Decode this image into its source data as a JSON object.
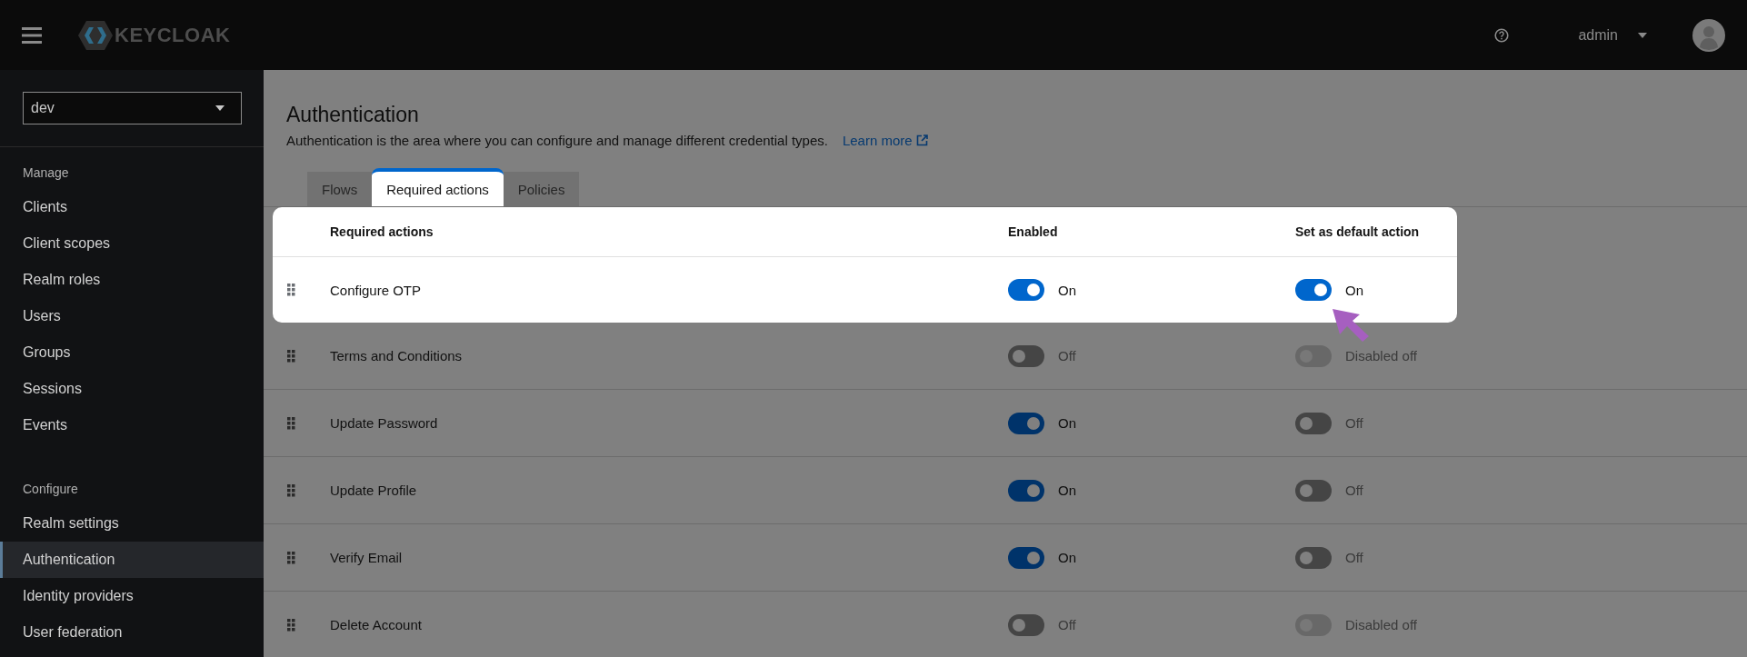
{
  "header": {
    "logo": "KEYCLOAK",
    "user": "admin"
  },
  "sidebar": {
    "realm": "dev",
    "sections": [
      {
        "title": "Manage",
        "items": [
          {
            "label": "Clients",
            "selected": false
          },
          {
            "label": "Client scopes",
            "selected": false
          },
          {
            "label": "Realm roles",
            "selected": false
          },
          {
            "label": "Users",
            "selected": false
          },
          {
            "label": "Groups",
            "selected": false
          },
          {
            "label": "Sessions",
            "selected": false
          },
          {
            "label": "Events",
            "selected": false
          }
        ]
      },
      {
        "title": "Configure",
        "items": [
          {
            "label": "Realm settings",
            "selected": false
          },
          {
            "label": "Authentication",
            "selected": true
          },
          {
            "label": "Identity providers",
            "selected": false
          },
          {
            "label": "User federation",
            "selected": false
          }
        ]
      }
    ]
  },
  "page": {
    "title": "Authentication",
    "description": "Authentication is the area where you can configure and manage different credential types.",
    "learn_more": "Learn more"
  },
  "tabs": [
    {
      "label": "Flows",
      "selected": false
    },
    {
      "label": "Required actions",
      "selected": true
    },
    {
      "label": "Policies",
      "selected": false
    }
  ],
  "table": {
    "columns": [
      "Required actions",
      "Enabled",
      "Set as default action"
    ],
    "rows": [
      {
        "name": "Configure OTP",
        "highlighted": true,
        "enabled": {
          "on": true,
          "disabled": false,
          "label": "On"
        },
        "default": {
          "on": true,
          "disabled": false,
          "label": "On"
        }
      },
      {
        "name": "Terms and Conditions",
        "highlighted": false,
        "enabled": {
          "on": false,
          "disabled": false,
          "label": "Off"
        },
        "default": {
          "on": false,
          "disabled": true,
          "label": "Disabled off"
        }
      },
      {
        "name": "Update Password",
        "highlighted": false,
        "enabled": {
          "on": true,
          "disabled": false,
          "label": "On"
        },
        "default": {
          "on": false,
          "disabled": false,
          "label": "Off"
        }
      },
      {
        "name": "Update Profile",
        "highlighted": false,
        "enabled": {
          "on": true,
          "disabled": false,
          "label": "On"
        },
        "default": {
          "on": false,
          "disabled": false,
          "label": "Off"
        }
      },
      {
        "name": "Verify Email",
        "highlighted": false,
        "enabled": {
          "on": true,
          "disabled": false,
          "label": "On"
        },
        "default": {
          "on": false,
          "disabled": false,
          "label": "Off"
        }
      },
      {
        "name": "Delete Account",
        "highlighted": false,
        "enabled": {
          "on": false,
          "disabled": false,
          "label": "Off"
        },
        "default": {
          "on": false,
          "disabled": true,
          "label": "Disabled off"
        }
      }
    ]
  }
}
